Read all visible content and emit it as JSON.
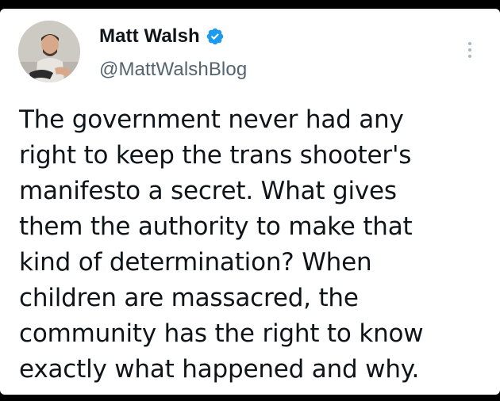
{
  "author": {
    "display_name": "Matt Walsh",
    "handle": "@MattWalshBlog",
    "verified_icon": "verified-badge-icon",
    "verified_color": "#1d9bf0",
    "avatar_icon": "profile-photo"
  },
  "tweet": {
    "text": "The government never had any\nright to keep the trans shooter's\nmanifesto a secret. What gives\nthem the authority to make that\nkind of determination? When\nchildren are massacred, the\ncommunity has the right to know\nexactly what happened and why."
  },
  "menu": {
    "icon": "more-options-icon"
  }
}
